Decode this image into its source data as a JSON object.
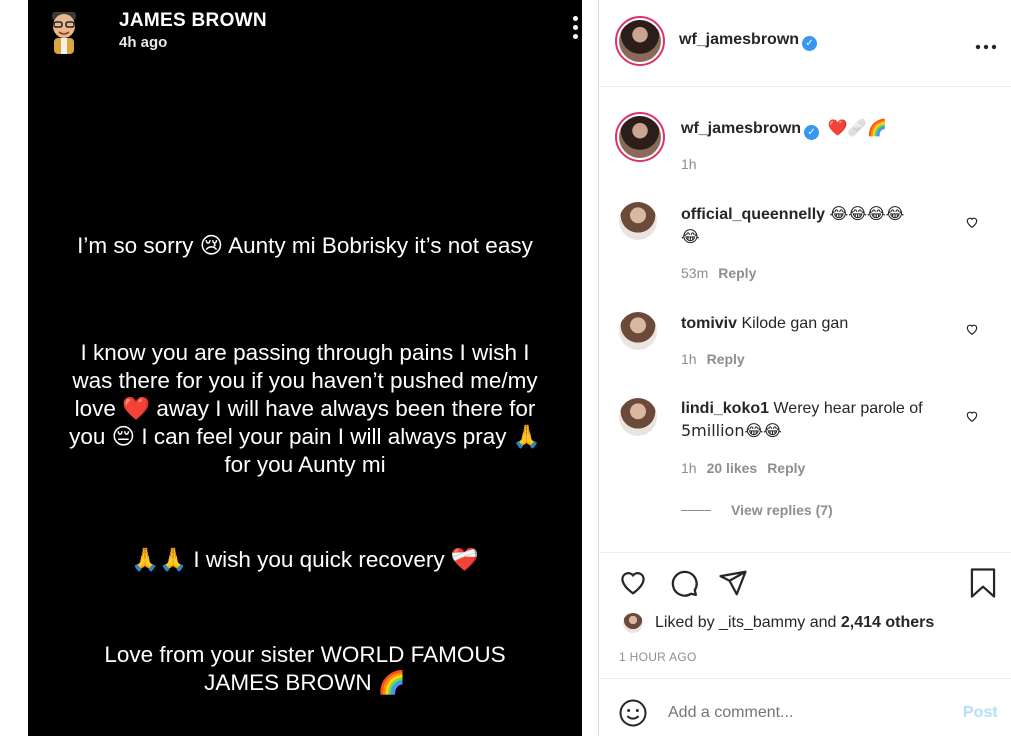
{
  "story": {
    "author": "JAMES BROWN",
    "time": "4h ago",
    "more_icon": "more-vertical-icon",
    "lines": [
      "I’m so sorry 😢 Aunty mi Bobrisky it’s not easy",
      "I know you are passing through pains I wish I",
      "was there for you if you haven’t pushed me/my",
      "love ❤️ away I will have always been there for",
      "you 😔 I can feel your pain I will always pray 🙏",
      "for you Aunty mi",
      "🙏🙏 I wish you quick recovery ❤️‍🩹",
      "Love from your sister WORLD FAMOUS",
      "JAMES BROWN 🌈"
    ]
  },
  "post": {
    "header_username": "wf_jamesbrown",
    "more_icon": "more-horizontal-icon",
    "caption": {
      "username": "wf_jamesbrown",
      "text": "❤️🩹🌈",
      "time": "1h"
    },
    "comments": [
      {
        "username": "official_queennelly",
        "text_line1": "😂😂😂😂",
        "text_line2": "😂",
        "time": "53m",
        "likes": "",
        "reply": "Reply"
      },
      {
        "username": "tomiviv",
        "text_line1": "Kilode gan gan",
        "text_line2": "",
        "time": "1h",
        "likes": "",
        "reply": "Reply"
      },
      {
        "username": "lindi_koko1",
        "text_line1": "Werey hear parole of",
        "text_line2": "5million😂😂",
        "time": "1h",
        "likes": "20 likes",
        "reply": "Reply"
      }
    ],
    "view_replies": "View replies (7)",
    "liked_by_prefix": "Liked by",
    "liked_by_user": "_its_bammy",
    "liked_by_and": "and",
    "liked_by_others": "2,414 others",
    "timestamp": "1 HOUR AGO",
    "comment_placeholder": "Add a comment...",
    "post_button": "Post",
    "colors": {
      "accent": "#0095f6",
      "verified": "#3897f0",
      "muted": "#8e8e8e",
      "post_disabled": "#b2dffc"
    }
  }
}
